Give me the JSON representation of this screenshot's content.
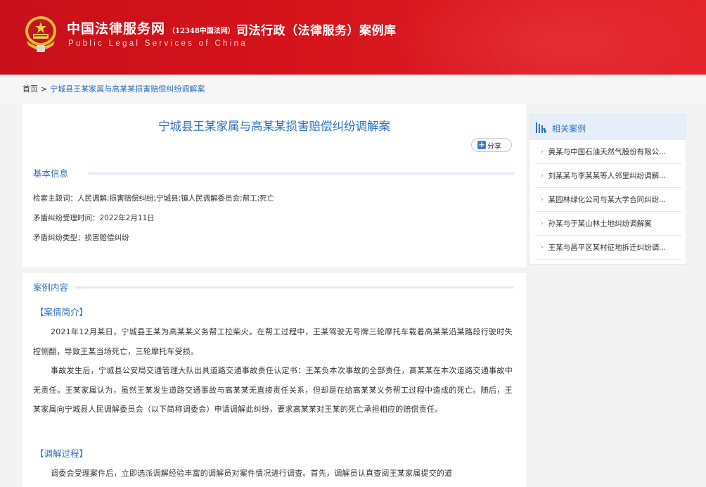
{
  "header": {
    "site_name": "中国法律服务网",
    "site_name_sub": "（12348中国法网）",
    "site_name_en": "Public Legal Services of China",
    "section_title": "司法行政（法律服务）案例库",
    "colors": {
      "primary": "#d4131b",
      "accent": "#2b73c1"
    }
  },
  "breadcrumb": {
    "home": "首页",
    "separator": ">",
    "current": "宁城县王某家属与高某某损害赔偿纠纷调解案"
  },
  "main": {
    "title": "宁城县王某家属与高某某损害赔偿纠纷调解案",
    "share_label": "分享",
    "basic_info": {
      "heading": "基本信息",
      "keywords_label": "检索主题词：",
      "keywords_value": "人民调解;损害赔偿纠纷;宁城县;镇人民调解委员会;帮工;死亡",
      "accept_time_label": "矛盾纠纷受理时间：",
      "accept_time_value": "2022年2月11日",
      "type_label": "矛盾纠纷类型：",
      "type_value": "损害赔偿纠纷"
    },
    "content": {
      "heading": "案例内容",
      "brief_heading": "【案情简介】",
      "brief_p1": "2021年12月某日，宁城县王某为高某某义务帮工拉柴火。在帮工过程中，王某驾驶无号牌三轮摩托车载着高某某沿某路段行驶时失控侧翻，导致王某当场死亡，三轮摩托车受损。",
      "brief_p2": "事故发生后，宁城县公安局交通管理大队出具道路交通事故责任认定书：王某负本次事故的全部责任，高某某在本次道路交通事故中无责任。王某家属认为，虽然王某发生道路交通事故与高某某无直接责任关系，但却是在给高某某义务帮工过程中造成的死亡。随后，王某家属向宁城县人民调解委员会（以下简称调委会）申请调解此纠纷，要求高某某对王某的死亡承担相应的赔偿责任。",
      "process_heading": "【调解过程】",
      "process_p1": "调委会受理案件后，立即选派调解经验丰富的调解员对案件情况进行调查。首先，调解员认真查阅王某家属提交的道"
    }
  },
  "sidebar": {
    "title": "相关案例",
    "items": [
      {
        "label": "黄某与中国石油天然气股份有限公..."
      },
      {
        "label": "刘某某与李某某等人邻里纠纷调解..."
      },
      {
        "label": "某园林绿化公司与某大学合同纠纷..."
      },
      {
        "label": "孙某与于某山林土地纠纷调解案"
      },
      {
        "label": "王某与昌平区某村征地拆迁纠纷调..."
      }
    ]
  }
}
